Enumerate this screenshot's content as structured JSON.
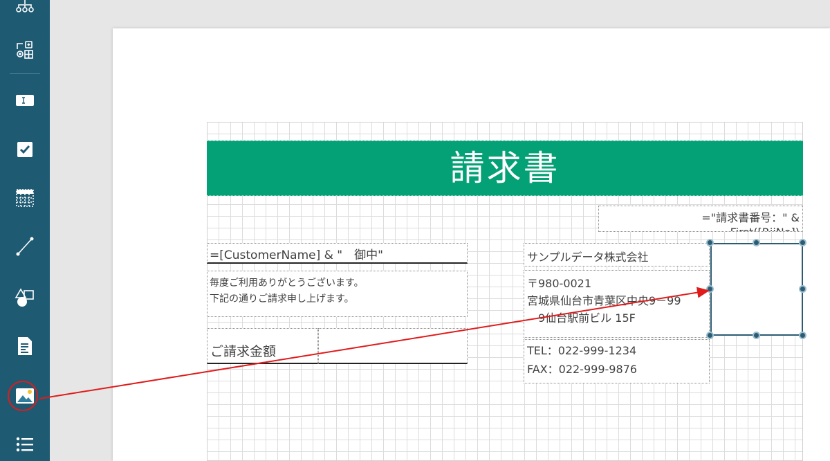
{
  "sidebar": {
    "tools": [
      {
        "name": "hierarchy-tool",
        "icon": "hierarchy-icon"
      },
      {
        "name": "shape-grid-tool",
        "icon": "shape-grid-icon"
      },
      {
        "name": "textbox-tool",
        "icon": "textbox-icon"
      },
      {
        "name": "checkbox-tool",
        "icon": "checkbox-icon"
      },
      {
        "name": "table-tool",
        "icon": "table-icon"
      },
      {
        "name": "line-tool",
        "icon": "line-icon"
      },
      {
        "name": "shape-tool",
        "icon": "shape-icon"
      },
      {
        "name": "document-tool",
        "icon": "document-icon"
      },
      {
        "name": "image-tool",
        "icon": "image-icon",
        "highlighted": true
      },
      {
        "name": "list-tool",
        "icon": "list-icon"
      }
    ],
    "highlight_color": "#e01b1b"
  },
  "report": {
    "title": "請求書",
    "invoice_number_lines": [
      "=\"請求書番号：\" &",
      "First([RiiNo])"
    ],
    "customer_expression": "=[CustomerName] & \"　御中\"",
    "greeting_lines": [
      "毎度ご利用ありがとうございます。",
      "下記の通りご請求申し上げます。"
    ],
    "amount_label": "ご請求金額",
    "amount_value": "",
    "company_name": "サンプルデータ株式会社",
    "address_lines": [
      "〒980-0021",
      "宮城県仙台市青葉区中央9－99",
      "　9仙台駅前ビル 15F"
    ],
    "contact_lines": [
      "TEL：022-999-1234",
      "FAX：022-999-9876"
    ]
  },
  "colors": {
    "sidebar": "#1f5a73",
    "title_bar": "#05a176",
    "selection": "#2c5b72",
    "arrow": "#e01b1b"
  }
}
